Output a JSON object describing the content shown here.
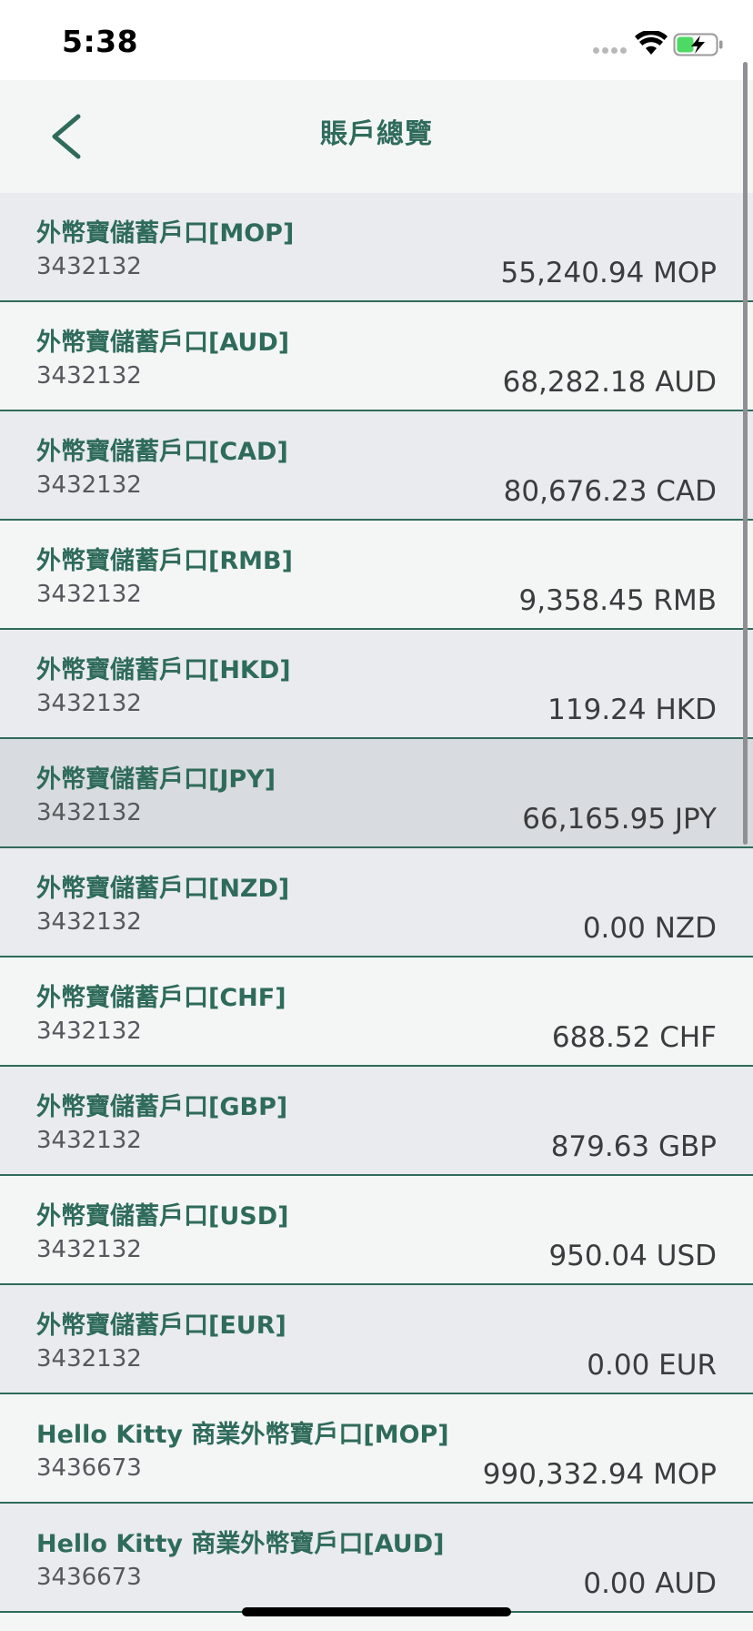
{
  "status_bar": {
    "time": "5:38"
  },
  "nav": {
    "title": "賬戶總覽"
  },
  "accounts": [
    {
      "name": "外幣寶儲蓄戶口[MOP]",
      "number": "3432132",
      "balance": "55,240.94 MOP"
    },
    {
      "name": "外幣寶儲蓄戶口[AUD]",
      "number": "3432132",
      "balance": "68,282.18 AUD"
    },
    {
      "name": "外幣寶儲蓄戶口[CAD]",
      "number": "3432132",
      "balance": "80,676.23 CAD"
    },
    {
      "name": "外幣寶儲蓄戶口[RMB]",
      "number": "3432132",
      "balance": "9,358.45 RMB"
    },
    {
      "name": "外幣寶儲蓄戶口[HKD]",
      "number": "3432132",
      "balance": "119.24 HKD"
    },
    {
      "name": "外幣寶儲蓄戶口[JPY]",
      "number": "3432132",
      "balance": "66,165.95 JPY"
    },
    {
      "name": "外幣寶儲蓄戶口[NZD]",
      "number": "3432132",
      "balance": "0.00 NZD"
    },
    {
      "name": "外幣寶儲蓄戶口[CHF]",
      "number": "3432132",
      "balance": "688.52 CHF"
    },
    {
      "name": "外幣寶儲蓄戶口[GBP]",
      "number": "3432132",
      "balance": "879.63 GBP"
    },
    {
      "name": "外幣寶儲蓄戶口[USD]",
      "number": "3432132",
      "balance": "950.04 USD"
    },
    {
      "name": "外幣寶儲蓄戶口[EUR]",
      "number": "3432132",
      "balance": "0.00 EUR"
    },
    {
      "name": "Hello Kitty 商業外幣寶戶口[MOP]",
      "number": "3436673",
      "balance": "990,332.94 MOP"
    },
    {
      "name": "Hello Kitty 商業外幣寶戶口[AUD]",
      "number": "3436673",
      "balance": "0.00 AUD"
    }
  ],
  "icons": {
    "back": "chevron-left-icon",
    "wifi": "wifi-icon",
    "battery": "battery-charging-icon",
    "signal": "signal-dots-icon"
  },
  "colors": {
    "accent": "#2f6b5a",
    "row_odd": "#e9ebee",
    "row_even": "#f4f6f6",
    "row_selected": "#d8dbdf"
  }
}
